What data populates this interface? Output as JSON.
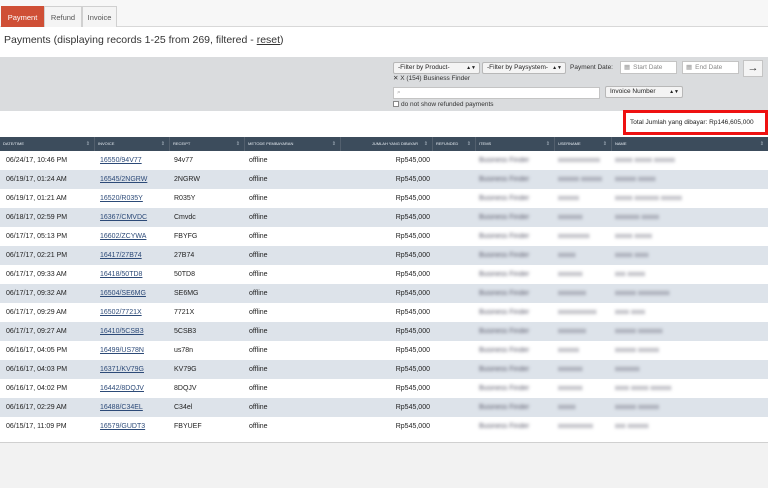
{
  "tabs": [
    {
      "label": "Payment",
      "active": true
    },
    {
      "label": "Refund",
      "active": false
    },
    {
      "label": "Invoice",
      "active": false
    }
  ],
  "page_title": {
    "prefix": "Payments (displaying records 1-25 from 269, filtered - ",
    "reset_label": "reset",
    "suffix": ")"
  },
  "filters": {
    "product_select": "-Filter by Product-",
    "selected_product": "X (154) Business Finder",
    "paysystem_select": "-Filter by Paysystem-",
    "payment_date_label": "Payment Date:",
    "start_date_placeholder": "Start Date",
    "end_date_placeholder": "End Date",
    "go_icon": "arrow-right-icon",
    "search_icon": "search-icon",
    "search_value": "",
    "search_field_select": "Invoice Number",
    "refund_checkbox_label": "do not show refunded payments",
    "refund_checkbox_checked": false
  },
  "total": {
    "label": "Total Jumlah yang dibayar:",
    "value": "Rp146,605,000"
  },
  "table": {
    "columns": [
      "DATE/TIME",
      "INVOICE",
      "RECEIPT",
      "METODE PEMBAYARAN",
      "JUMLAH YANG DIBAYAR",
      "REFUNDED",
      "ITEMS",
      "USERNAME",
      "NAME"
    ],
    "rows": [
      {
        "datetime": "06/24/17, 10:46 PM",
        "invoice": "16550/94V77",
        "receipt": "94v77",
        "method": "offline",
        "amount": "Rp545,000",
        "refunded": "",
        "items": "Business Finder",
        "username": "xxxxxxxxxxxx",
        "name": "xxxxx xxxxx xxxxxx"
      },
      {
        "datetime": "06/19/17, 01:24 AM",
        "invoice": "16545/2NGRW",
        "receipt": "2NGRW",
        "method": "offline",
        "amount": "Rp545,000",
        "refunded": "",
        "items": "Business Finder",
        "username": "xxxxxx xxxxxx",
        "name": "xxxxxx xxxxx"
      },
      {
        "datetime": "06/19/17, 01:21 AM",
        "invoice": "16520/R035Y",
        "receipt": "R035Y",
        "method": "offline",
        "amount": "Rp545,000",
        "refunded": "",
        "items": "Business Finder",
        "username": "xxxxxx",
        "name": "xxxxx xxxxxxx xxxxxx"
      },
      {
        "datetime": "06/18/17, 02:59 PM",
        "invoice": "16367/CMVDC",
        "receipt": "Cmvdc",
        "method": "offline",
        "amount": "Rp545,000",
        "refunded": "",
        "items": "Business Finder",
        "username": "xxxxxxx",
        "name": "xxxxxxx xxxxx"
      },
      {
        "datetime": "06/17/17, 05:13 PM",
        "invoice": "16602/ZCYWA",
        "receipt": "FBYFG",
        "method": "offline",
        "amount": "Rp545,000",
        "refunded": "",
        "items": "Business Finder",
        "username": "xxxxxxxxx",
        "name": "xxxxx xxxxx"
      },
      {
        "datetime": "06/17/17, 02:21 PM",
        "invoice": "16417/27B74",
        "receipt": "27B74",
        "method": "offline",
        "amount": "Rp545,000",
        "refunded": "",
        "items": "Business Finder",
        "username": "xxxxx",
        "name": "xxxxx xxxx"
      },
      {
        "datetime": "06/17/17, 09:33 AM",
        "invoice": "16418/50TD8",
        "receipt": "50TD8",
        "method": "offline",
        "amount": "Rp545,000",
        "refunded": "",
        "items": "Business Finder",
        "username": "xxxxxxx",
        "name": "xxx xxxxx"
      },
      {
        "datetime": "06/17/17, 09:32 AM",
        "invoice": "16504/SE6MG",
        "receipt": "SE6MG",
        "method": "offline",
        "amount": "Rp545,000",
        "refunded": "",
        "items": "Business Finder",
        "username": "xxxxxxxx",
        "name": "xxxxxx xxxxxxxxx"
      },
      {
        "datetime": "06/17/17, 09:29 AM",
        "invoice": "16502/7721X",
        "receipt": "7721X",
        "method": "offline",
        "amount": "Rp545,000",
        "refunded": "",
        "items": "Business Finder",
        "username": "xxxxxxxxxxx",
        "name": "xxxx xxxx"
      },
      {
        "datetime": "06/17/17, 09:27 AM",
        "invoice": "16410/5CSB3",
        "receipt": "5CSB3",
        "method": "offline",
        "amount": "Rp545,000",
        "refunded": "",
        "items": "Business Finder",
        "username": "xxxxxxxx",
        "name": "xxxxxx xxxxxxx"
      },
      {
        "datetime": "06/16/17, 04:05 PM",
        "invoice": "16499/US78N",
        "receipt": "us78n",
        "method": "offline",
        "amount": "Rp545,000",
        "refunded": "",
        "items": "Business Finder",
        "username": "xxxxxx",
        "name": "xxxxxx xxxxxx"
      },
      {
        "datetime": "06/16/17, 04:03 PM",
        "invoice": "16371/KV79G",
        "receipt": "KV79G",
        "method": "offline",
        "amount": "Rp545,000",
        "refunded": "",
        "items": "Business Finder",
        "username": "xxxxxxx",
        "name": "xxxxxxx"
      },
      {
        "datetime": "06/16/17, 04:02 PM",
        "invoice": "16442/8DQJV",
        "receipt": "8DQJV",
        "method": "offline",
        "amount": "Rp545,000",
        "refunded": "",
        "items": "Business Finder",
        "username": "xxxxxxx",
        "name": "xxxx xxxxx xxxxxx"
      },
      {
        "datetime": "06/16/17, 02:29 AM",
        "invoice": "16488/C34EL",
        "receipt": "C34el",
        "method": "offline",
        "amount": "Rp545,000",
        "refunded": "",
        "items": "Business Finder",
        "username": "xxxxx",
        "name": "xxxxxx xxxxxx"
      },
      {
        "datetime": "06/15/17, 11:09 PM",
        "invoice": "16579/GUDT3",
        "receipt": "FBYUEF",
        "method": "offline",
        "amount": "Rp545,000",
        "refunded": "",
        "items": "Business Finder",
        "username": "xxxxxxxxxx",
        "name": "xxx xxxxxx"
      }
    ]
  },
  "colors": {
    "active_tab": "#cf4f36",
    "table_header": "#3c4c5c",
    "stripe": "#dde3ea",
    "highlight_border": "#ee1111"
  }
}
